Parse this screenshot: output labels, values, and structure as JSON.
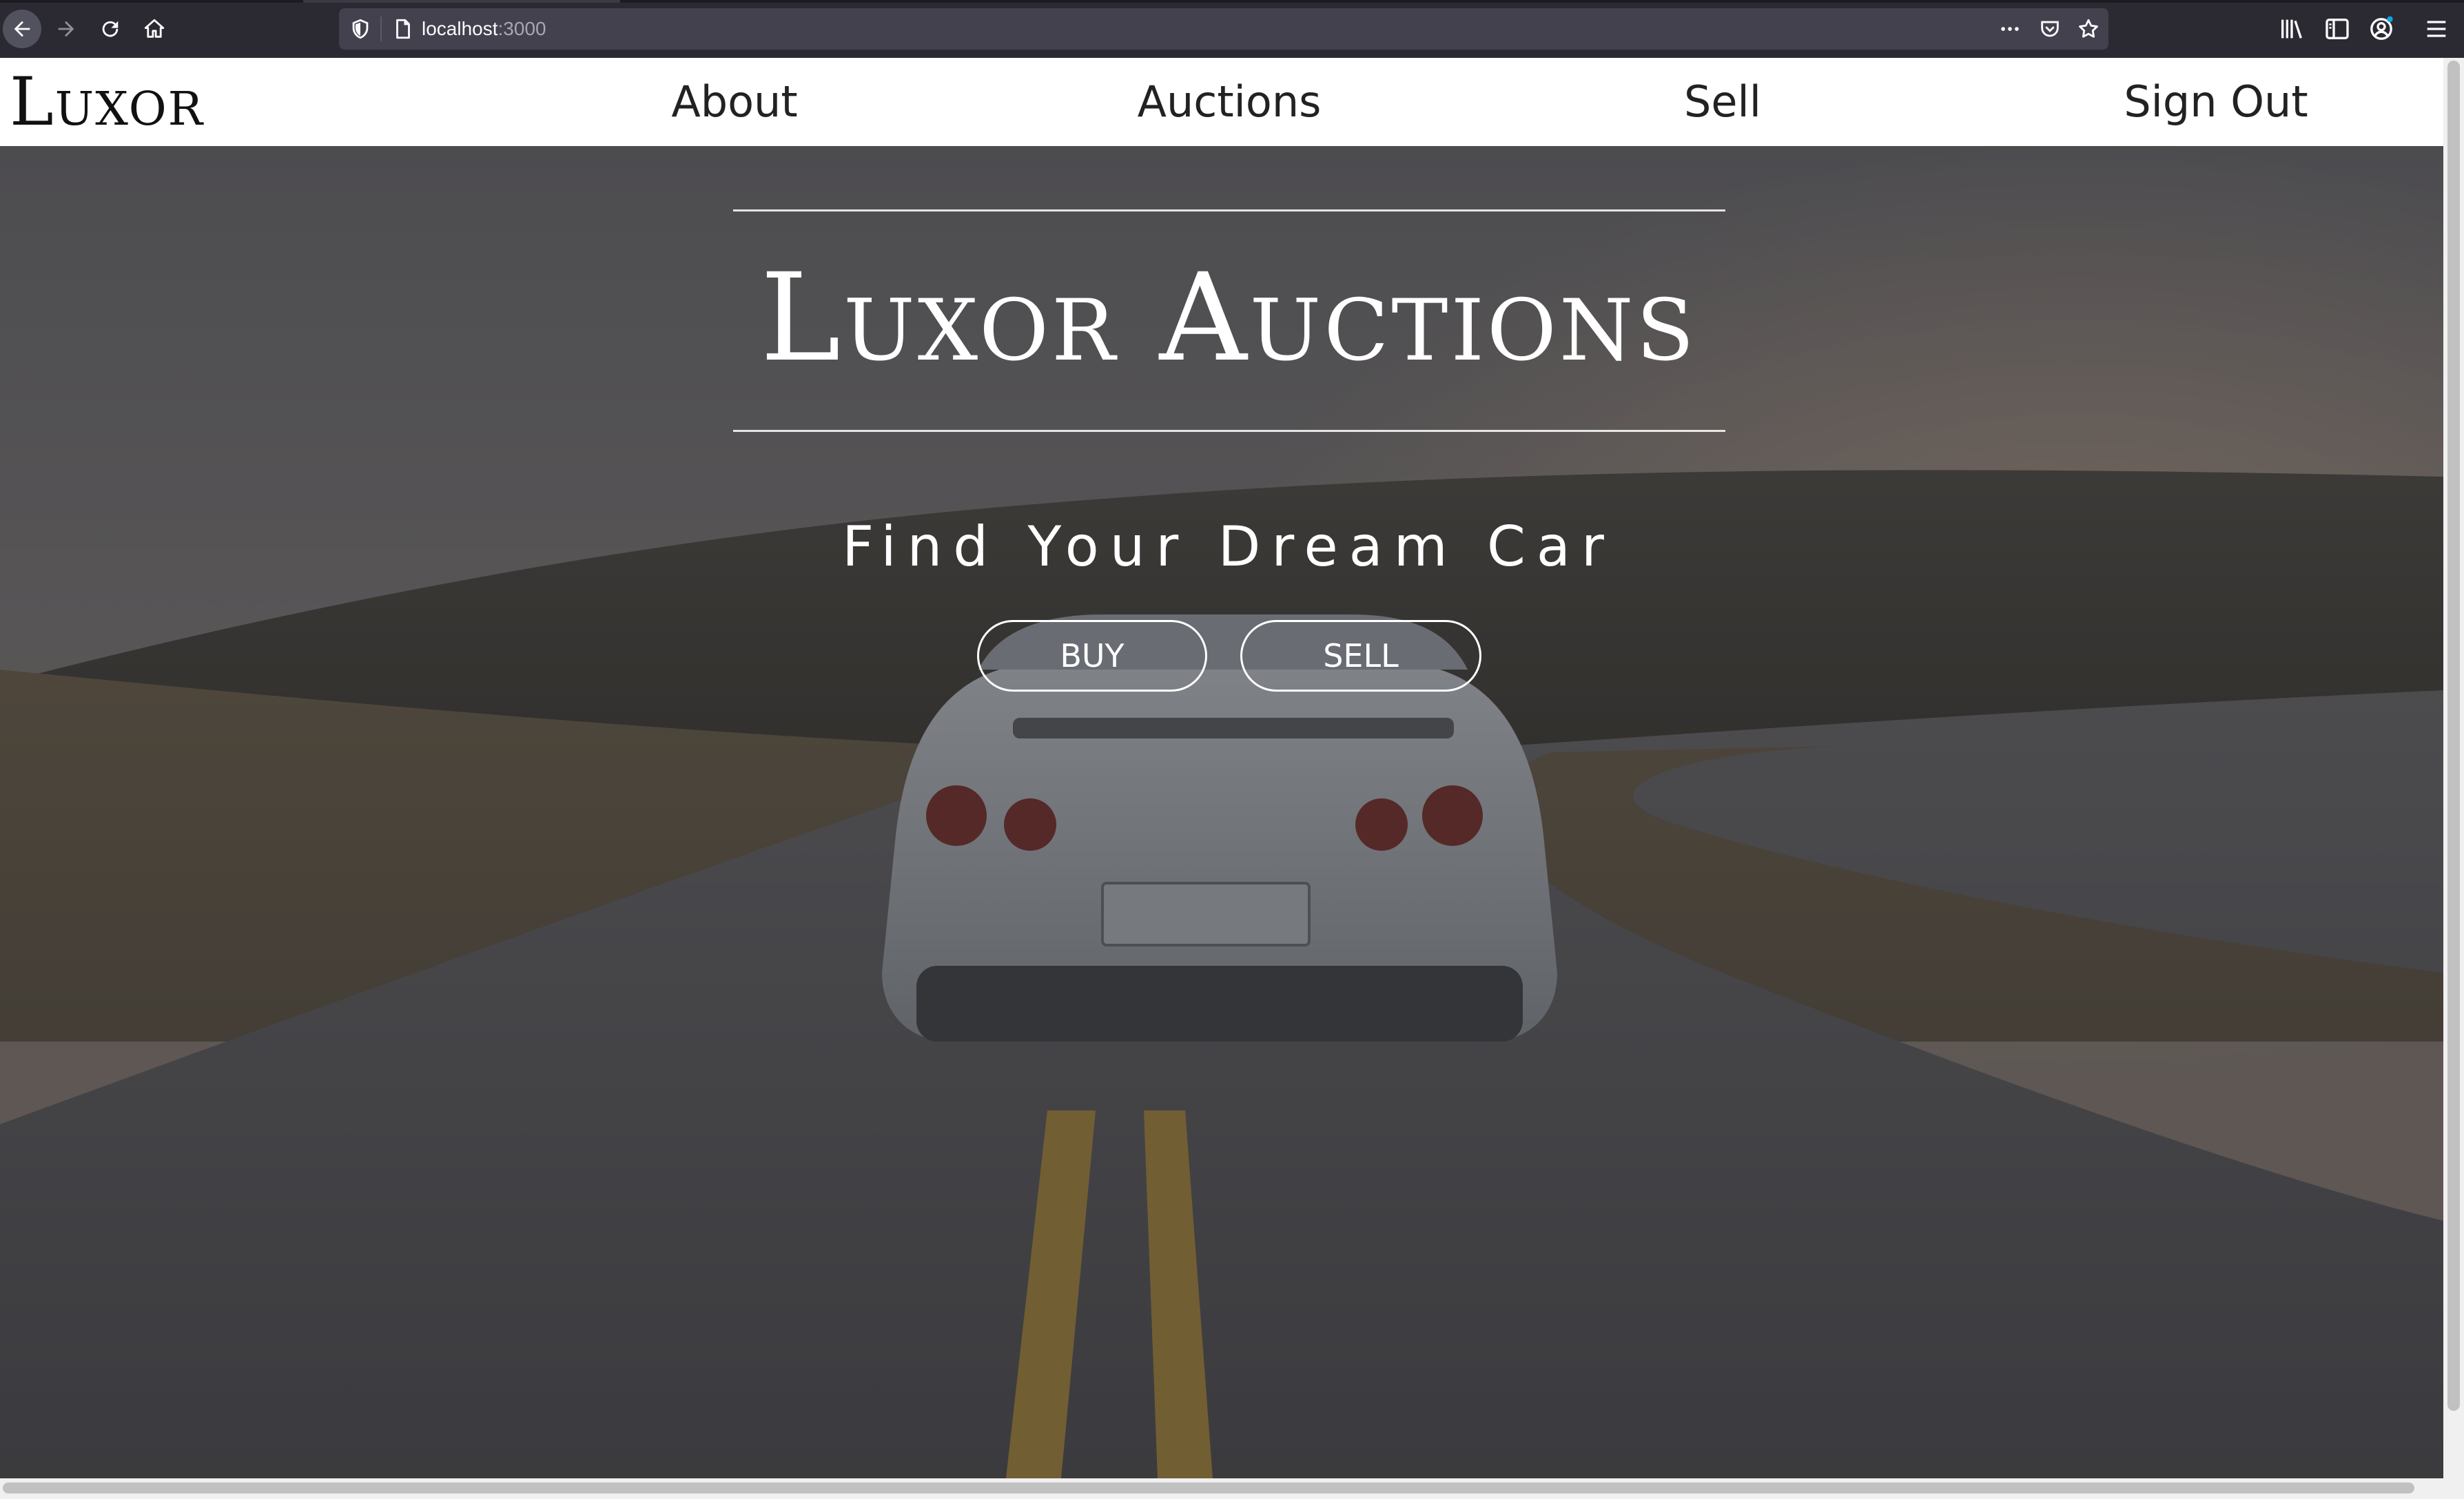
{
  "browser": {
    "url_host": "localhost",
    "url_port": ":3000",
    "icons": {
      "back": "arrow-left-icon",
      "forward": "arrow-right-icon",
      "reload": "reload-icon",
      "home": "home-icon",
      "shield": "tracking-shield-icon",
      "page": "page-icon",
      "more": "more-dots-icon",
      "pocket": "pocket-icon",
      "bookmark": "star-icon",
      "library": "library-icon",
      "sidebar": "sidebar-icon",
      "account": "account-icon",
      "menu": "hamburger-menu-icon"
    },
    "colors": {
      "toolbar": "#2b2a33",
      "urlbar": "#42414d"
    }
  },
  "site": {
    "brand": "Luxor",
    "nav": {
      "about": "About",
      "auctions": "Auctions",
      "sell": "Sell",
      "sign_out": "Sign Out"
    }
  },
  "hero": {
    "title": "Luxor Auctions",
    "subtitle": "Find Your Dream Car",
    "buy_label": "BUY",
    "sell_label": "SELL",
    "background": "photo of a white sports car on a winding country road at dusk, dimmed by a dark overlay"
  }
}
